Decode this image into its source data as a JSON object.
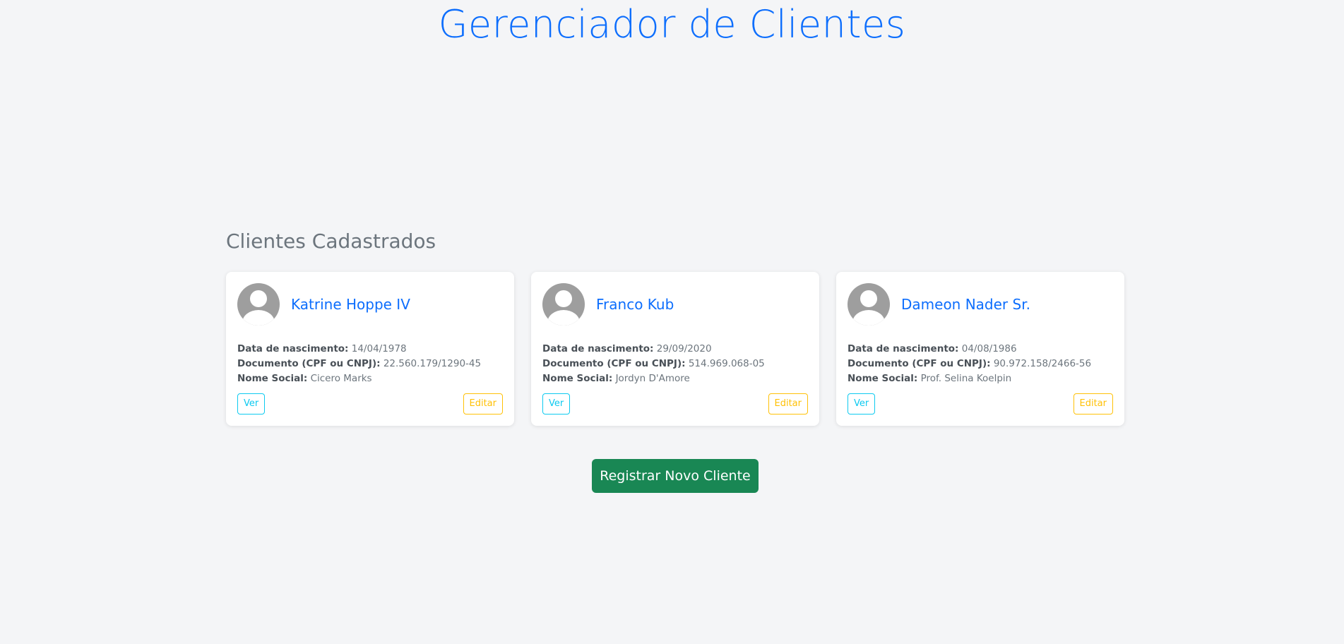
{
  "header": {
    "title": "Gerenciador de Clientes"
  },
  "section": {
    "title": "Clientes Cadastrados"
  },
  "labels": {
    "birth": "Data de nascimento:",
    "document": "Documento (CPF ou CNPJ):",
    "social_name": "Nome Social:",
    "view": "Ver",
    "edit": "Editar"
  },
  "clients": [
    {
      "name": "Katrine Hoppe IV",
      "birth": "14/04/1978",
      "document": "22.560.179/1290-45",
      "social_name": "Cicero Marks"
    },
    {
      "name": "Franco Kub",
      "birth": "29/09/2020",
      "document": "514.969.068-05",
      "social_name": "Jordyn D'Amore"
    },
    {
      "name": "Dameon Nader Sr.",
      "birth": "04/08/1986",
      "document": "90.972.158/2466-56",
      "social_name": "Prof. Selina Koelpin"
    }
  ],
  "actions": {
    "register_label": "Registrar Novo Cliente"
  },
  "colors": {
    "primary": "#0d6efd",
    "info": "#0dcaf0",
    "warning": "#ffc107",
    "success": "#198754",
    "background": "#f4f5f7"
  }
}
